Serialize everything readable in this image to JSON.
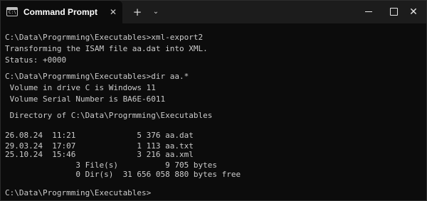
{
  "window": {
    "tab_title": "Command Prompt",
    "tab_icon_glyph": "C:\\",
    "close_tab_glyph": "✕",
    "new_tab_glyph": "+",
    "dropdown_glyph": "⌄",
    "close_window_glyph": "✕"
  },
  "colors": {
    "terminal_background": "#0c0c0c",
    "terminal_text": "#cccccc",
    "titlebar_background": "#1c1c1c",
    "tab_background": "#0c0c0c"
  },
  "terminal": {
    "lines": [
      "C:\\Data\\Progrmming\\Executables>xml-export2",
      "Transforming the ISAM file aa.dat into XML.",
      "Status: +0000",
      "",
      "C:\\Data\\Progrmming\\Executables>dir aa.*",
      " Volume in drive C is Windows 11",
      " Volume Serial Number is BA6E-6011",
      "",
      " Directory of C:\\Data\\Progrmming\\Executables",
      "",
      "26.08.24  11:21             5 376 aa.dat",
      "29.03.24  17:07             1 113 aa.txt",
      "25.10.24  15:46             3 216 aa.xml",
      "               3 File(s)          9 705 bytes",
      "               0 Dir(s)  31 656 058 880 bytes free",
      "",
      "C:\\Data\\Progrmming\\Executables>"
    ]
  }
}
